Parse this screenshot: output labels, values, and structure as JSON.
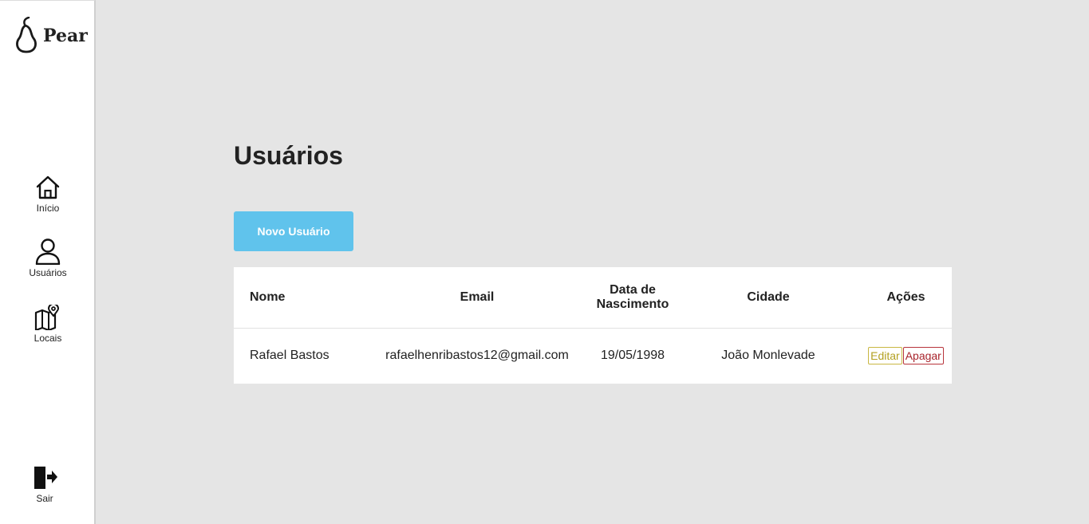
{
  "app": {
    "brand": "Pear"
  },
  "sidebar": {
    "items": [
      {
        "label": "Início",
        "icon": "home-icon"
      },
      {
        "label": "Usuários",
        "icon": "user-icon"
      },
      {
        "label": "Locais",
        "icon": "map-icon"
      }
    ],
    "logout": {
      "label": "Sair",
      "icon": "logout-icon"
    }
  },
  "main": {
    "title": "Usuários",
    "new_button": "Novo Usuário",
    "table": {
      "headers": [
        "Nome",
        "Email",
        "Data de Nascimento",
        "Cidade",
        "Ações"
      ],
      "rows": [
        {
          "nome": "Rafael Bastos",
          "email": "rafaelhenribastos12@gmail.com",
          "data": "19/05/1998",
          "cidade": "João Monlevade",
          "edit": "Editar",
          "delete": "Apagar"
        }
      ]
    }
  },
  "colors": {
    "accent": "#60c3ec",
    "edit": "#b3a021",
    "delete": "#a8242c",
    "background": "#e5e5e5"
  }
}
